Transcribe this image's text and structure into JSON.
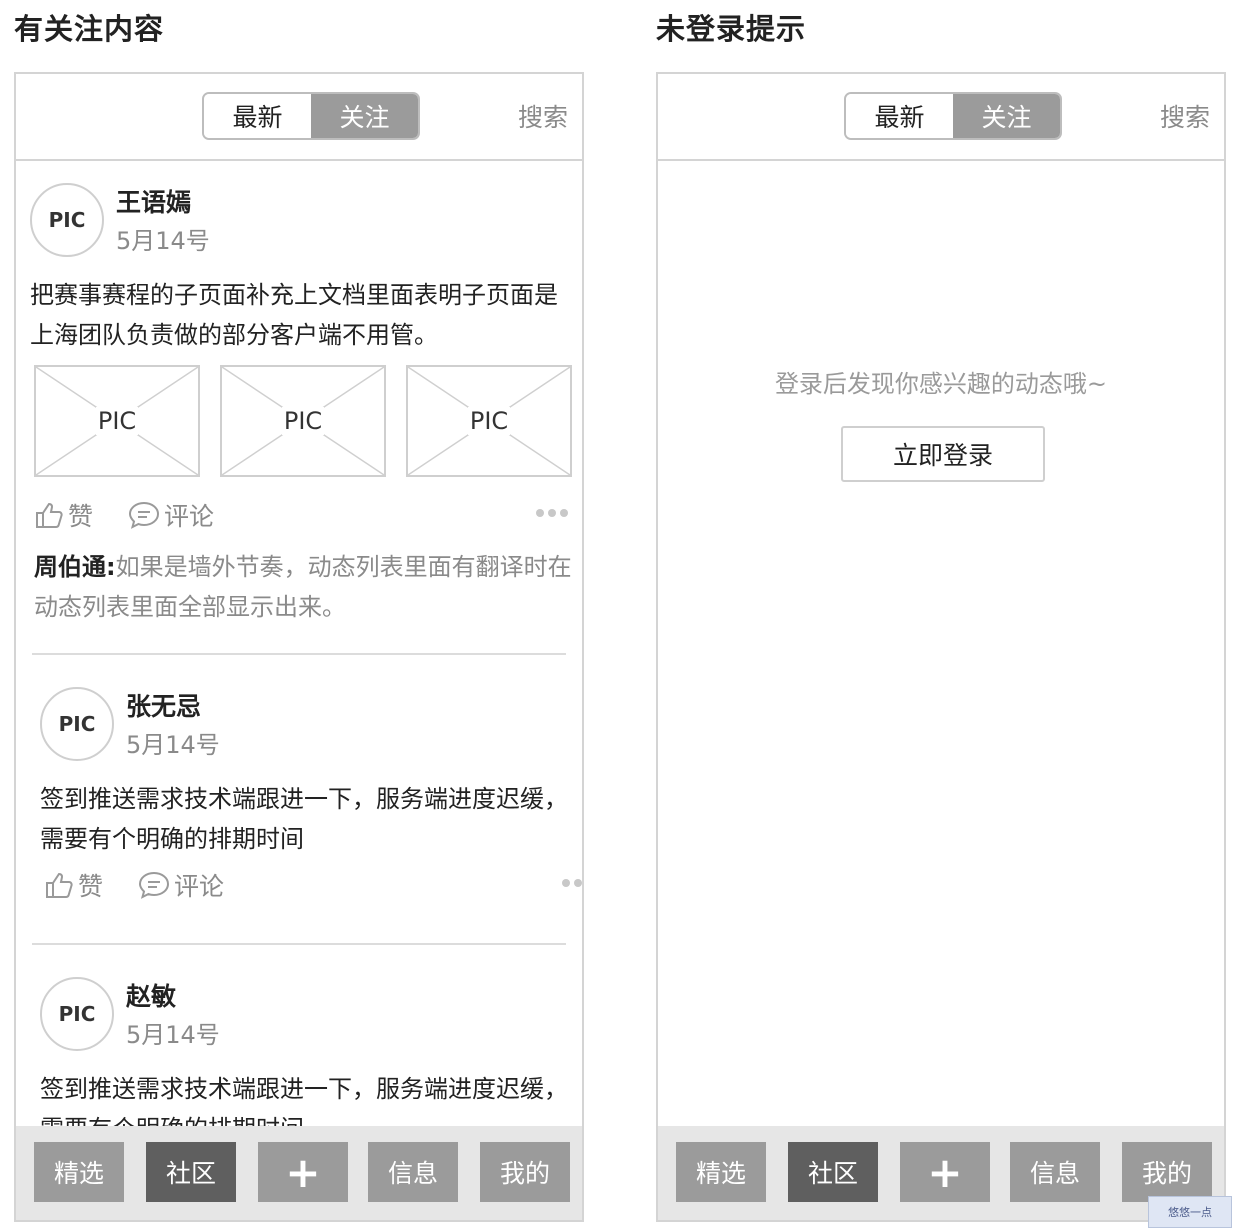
{
  "left": {
    "section_title": "有关注内容",
    "topbar": {
      "tabs": [
        {
          "label": "最新",
          "active": false
        },
        {
          "label": "关注",
          "active": true
        }
      ],
      "search_label": "搜索"
    },
    "posts": [
      {
        "avatar": "PIC",
        "name": "王语嫣",
        "date": "5月14号",
        "text": "把赛事赛程的子页面补充上文档里面表明子页面是上海团队负责做的部分客户端不用管。",
        "pics": [
          "PIC",
          "PIC",
          "PIC"
        ],
        "like_label": "赞",
        "comment_label": "评论",
        "comment_author": "周伯通:",
        "comment_text": "如果是墙外节奏，动态列表里面有翻译时在动态列表里面全部显示出来。"
      },
      {
        "avatar": "PIC",
        "name": "张无忌",
        "date": "5月14号",
        "text": "签到推送需求技术端跟进一下，服务端进度迟缓，需要有个明确的排期时间",
        "like_label": "赞",
        "comment_label": "评论"
      },
      {
        "avatar": "PIC",
        "name": "赵敏",
        "date": "5月14号",
        "text": "签到推送需求技术端跟进一下，服务端进度迟缓，需要有个明确的排期时间"
      }
    ],
    "tabbar": [
      {
        "label": "精选",
        "active": false
      },
      {
        "label": "社区",
        "active": true
      },
      {
        "label": "+",
        "active": false
      },
      {
        "label": "信息",
        "active": false
      },
      {
        "label": "我的",
        "active": false
      }
    ]
  },
  "right": {
    "section_title": "未登录提示",
    "topbar": {
      "tabs": [
        {
          "label": "最新",
          "active": false
        },
        {
          "label": "关注",
          "active": true
        }
      ],
      "search_label": "搜索"
    },
    "empty_tip": "登录后发现你感兴趣的动态哦~",
    "login_button": "立即登录",
    "tabbar": [
      {
        "label": "精选",
        "active": false
      },
      {
        "label": "社区",
        "active": true
      },
      {
        "label": "+",
        "active": false
      },
      {
        "label": "信息",
        "active": false
      },
      {
        "label": "我的",
        "active": false
      }
    ]
  },
  "watermark": "悠悠一点",
  "colors": {
    "tab_inactive": "#9b9b9b",
    "tab_active": "#5f5f5f",
    "border": "#d4d4d4",
    "muted_text": "#8a8a8a"
  }
}
